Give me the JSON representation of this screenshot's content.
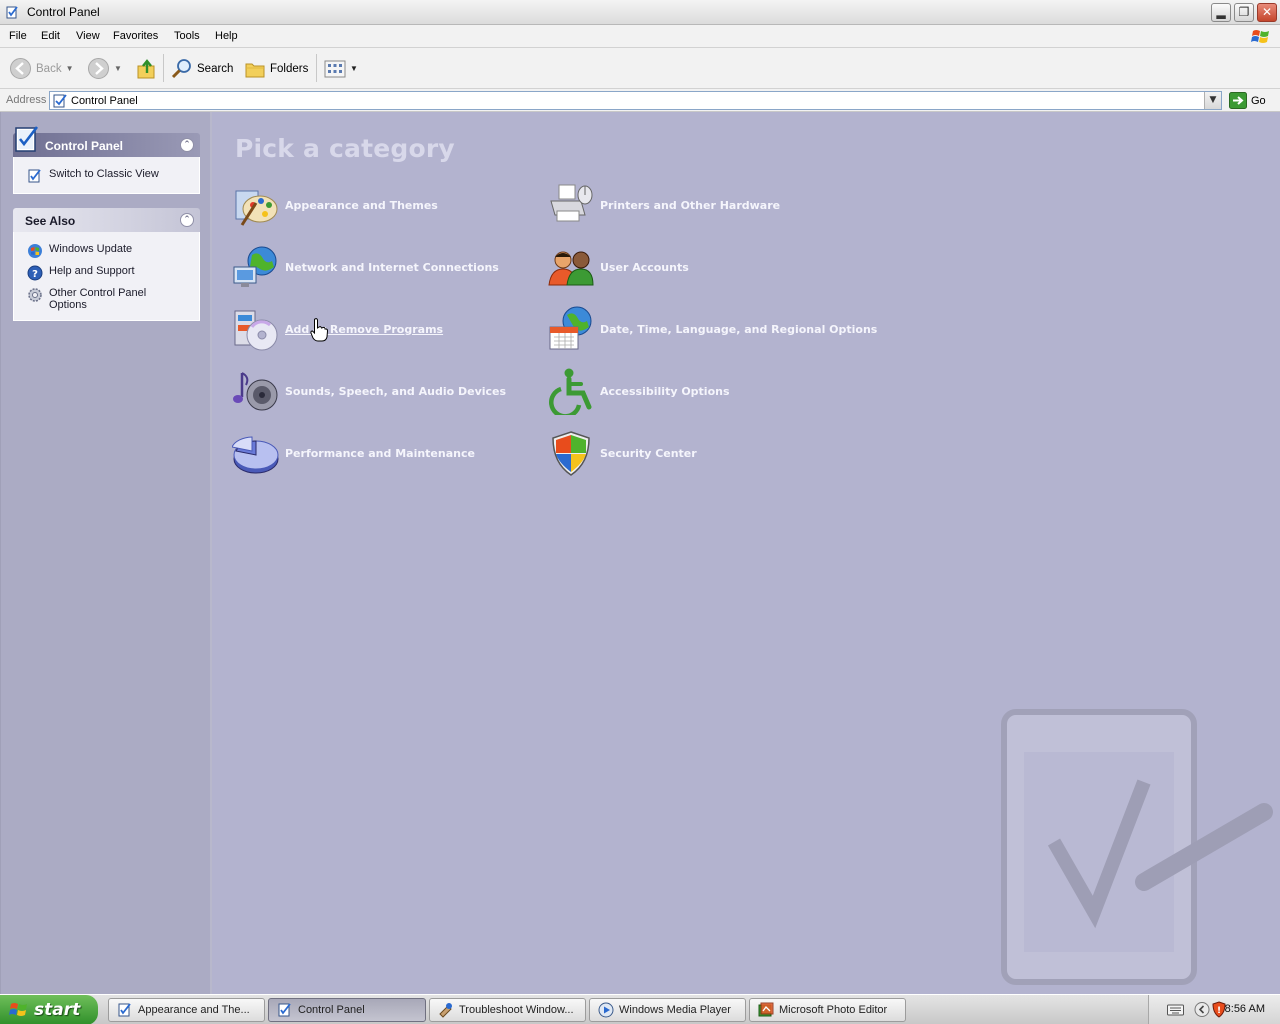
{
  "window": {
    "title": "Control Panel",
    "minimize_icon": "minimize-icon",
    "maximize_icon": "restore-icon",
    "close_icon": "close-icon"
  },
  "menu": [
    "File",
    "Edit",
    "View",
    "Favorites",
    "Tools",
    "Help"
  ],
  "toolbar": {
    "back_label": "Back",
    "search_label": "Search",
    "folders_label": "Folders"
  },
  "address": {
    "label": "Address",
    "value": "Control Panel",
    "go_label": "Go"
  },
  "left_pane": {
    "control_panel": {
      "title": "Control Panel",
      "items": [
        {
          "label": "Switch to Classic View",
          "icon": "classic-view-icon"
        }
      ]
    },
    "see_also": {
      "title": "See Also",
      "items": [
        {
          "label": "Windows Update",
          "icon": "windows-update-icon"
        },
        {
          "label": "Help and Support",
          "icon": "help-icon"
        },
        {
          "label": "Other Control Panel Options",
          "icon": "gear-icon"
        }
      ]
    }
  },
  "main": {
    "heading": "Pick a category",
    "categories": [
      {
        "label": "Appearance and Themes",
        "icon": "appearance-palette-icon"
      },
      {
        "label": "Printers and Other Hardware",
        "icon": "printer-icon"
      },
      {
        "label": "Network and Internet Connections",
        "icon": "network-globe-icon"
      },
      {
        "label": "User Accounts",
        "icon": "user-accounts-icon"
      },
      {
        "label": "Add or Remove Programs",
        "icon": "add-remove-programs-icon"
      },
      {
        "label": "Date, Time, Language, and Regional Options",
        "icon": "date-time-globe-icon"
      },
      {
        "label": "Sounds, Speech, and Audio Devices",
        "icon": "sound-speaker-icon"
      },
      {
        "label": "Accessibility Options",
        "icon": "accessibility-icon"
      },
      {
        "label": "Performance and Maintenance",
        "icon": "performance-pie-icon"
      },
      {
        "label": "Security Center",
        "icon": "security-shield-icon"
      }
    ],
    "hovered_category": "Add or Remove Programs"
  },
  "taskbar": {
    "start_label": "start",
    "tasks": [
      {
        "label": "Appearance and The...",
        "active": false
      },
      {
        "label": "Control Panel",
        "active": true
      },
      {
        "label": "Troubleshoot Window...",
        "active": false
      },
      {
        "label": "Windows Media Player",
        "active": false
      },
      {
        "label": "Microsoft Photo Editor",
        "active": false
      }
    ],
    "clock": "8:56 AM"
  },
  "colors": {
    "main_background": "#b3b3cf",
    "left_pane_background": "#ababc4",
    "heading_color": "#d8d8ea",
    "start_button": "#3a9a32"
  }
}
